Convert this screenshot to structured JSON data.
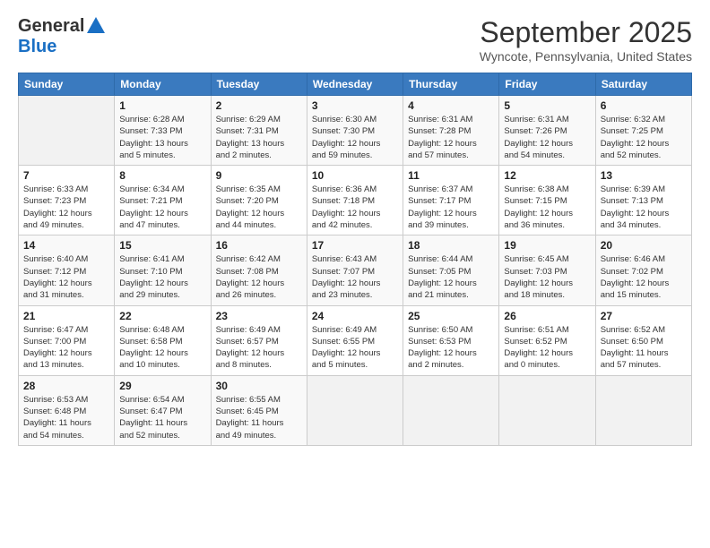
{
  "header": {
    "logo_general": "General",
    "logo_blue": "Blue",
    "month_title": "September 2025",
    "location": "Wyncote, Pennsylvania, United States"
  },
  "days_of_week": [
    "Sunday",
    "Monday",
    "Tuesday",
    "Wednesday",
    "Thursday",
    "Friday",
    "Saturday"
  ],
  "weeks": [
    [
      {
        "day": "",
        "info": ""
      },
      {
        "day": "1",
        "info": "Sunrise: 6:28 AM\nSunset: 7:33 PM\nDaylight: 13 hours\nand 5 minutes."
      },
      {
        "day": "2",
        "info": "Sunrise: 6:29 AM\nSunset: 7:31 PM\nDaylight: 13 hours\nand 2 minutes."
      },
      {
        "day": "3",
        "info": "Sunrise: 6:30 AM\nSunset: 7:30 PM\nDaylight: 12 hours\nand 59 minutes."
      },
      {
        "day": "4",
        "info": "Sunrise: 6:31 AM\nSunset: 7:28 PM\nDaylight: 12 hours\nand 57 minutes."
      },
      {
        "day": "5",
        "info": "Sunrise: 6:31 AM\nSunset: 7:26 PM\nDaylight: 12 hours\nand 54 minutes."
      },
      {
        "day": "6",
        "info": "Sunrise: 6:32 AM\nSunset: 7:25 PM\nDaylight: 12 hours\nand 52 minutes."
      }
    ],
    [
      {
        "day": "7",
        "info": "Sunrise: 6:33 AM\nSunset: 7:23 PM\nDaylight: 12 hours\nand 49 minutes."
      },
      {
        "day": "8",
        "info": "Sunrise: 6:34 AM\nSunset: 7:21 PM\nDaylight: 12 hours\nand 47 minutes."
      },
      {
        "day": "9",
        "info": "Sunrise: 6:35 AM\nSunset: 7:20 PM\nDaylight: 12 hours\nand 44 minutes."
      },
      {
        "day": "10",
        "info": "Sunrise: 6:36 AM\nSunset: 7:18 PM\nDaylight: 12 hours\nand 42 minutes."
      },
      {
        "day": "11",
        "info": "Sunrise: 6:37 AM\nSunset: 7:17 PM\nDaylight: 12 hours\nand 39 minutes."
      },
      {
        "day": "12",
        "info": "Sunrise: 6:38 AM\nSunset: 7:15 PM\nDaylight: 12 hours\nand 36 minutes."
      },
      {
        "day": "13",
        "info": "Sunrise: 6:39 AM\nSunset: 7:13 PM\nDaylight: 12 hours\nand 34 minutes."
      }
    ],
    [
      {
        "day": "14",
        "info": "Sunrise: 6:40 AM\nSunset: 7:12 PM\nDaylight: 12 hours\nand 31 minutes."
      },
      {
        "day": "15",
        "info": "Sunrise: 6:41 AM\nSunset: 7:10 PM\nDaylight: 12 hours\nand 29 minutes."
      },
      {
        "day": "16",
        "info": "Sunrise: 6:42 AM\nSunset: 7:08 PM\nDaylight: 12 hours\nand 26 minutes."
      },
      {
        "day": "17",
        "info": "Sunrise: 6:43 AM\nSunset: 7:07 PM\nDaylight: 12 hours\nand 23 minutes."
      },
      {
        "day": "18",
        "info": "Sunrise: 6:44 AM\nSunset: 7:05 PM\nDaylight: 12 hours\nand 21 minutes."
      },
      {
        "day": "19",
        "info": "Sunrise: 6:45 AM\nSunset: 7:03 PM\nDaylight: 12 hours\nand 18 minutes."
      },
      {
        "day": "20",
        "info": "Sunrise: 6:46 AM\nSunset: 7:02 PM\nDaylight: 12 hours\nand 15 minutes."
      }
    ],
    [
      {
        "day": "21",
        "info": "Sunrise: 6:47 AM\nSunset: 7:00 PM\nDaylight: 12 hours\nand 13 minutes."
      },
      {
        "day": "22",
        "info": "Sunrise: 6:48 AM\nSunset: 6:58 PM\nDaylight: 12 hours\nand 10 minutes."
      },
      {
        "day": "23",
        "info": "Sunrise: 6:49 AM\nSunset: 6:57 PM\nDaylight: 12 hours\nand 8 minutes."
      },
      {
        "day": "24",
        "info": "Sunrise: 6:49 AM\nSunset: 6:55 PM\nDaylight: 12 hours\nand 5 minutes."
      },
      {
        "day": "25",
        "info": "Sunrise: 6:50 AM\nSunset: 6:53 PM\nDaylight: 12 hours\nand 2 minutes."
      },
      {
        "day": "26",
        "info": "Sunrise: 6:51 AM\nSunset: 6:52 PM\nDaylight: 12 hours\nand 0 minutes."
      },
      {
        "day": "27",
        "info": "Sunrise: 6:52 AM\nSunset: 6:50 PM\nDaylight: 11 hours\nand 57 minutes."
      }
    ],
    [
      {
        "day": "28",
        "info": "Sunrise: 6:53 AM\nSunset: 6:48 PM\nDaylight: 11 hours\nand 54 minutes."
      },
      {
        "day": "29",
        "info": "Sunrise: 6:54 AM\nSunset: 6:47 PM\nDaylight: 11 hours\nand 52 minutes."
      },
      {
        "day": "30",
        "info": "Sunrise: 6:55 AM\nSunset: 6:45 PM\nDaylight: 11 hours\nand 49 minutes."
      },
      {
        "day": "",
        "info": ""
      },
      {
        "day": "",
        "info": ""
      },
      {
        "day": "",
        "info": ""
      },
      {
        "day": "",
        "info": ""
      }
    ]
  ]
}
